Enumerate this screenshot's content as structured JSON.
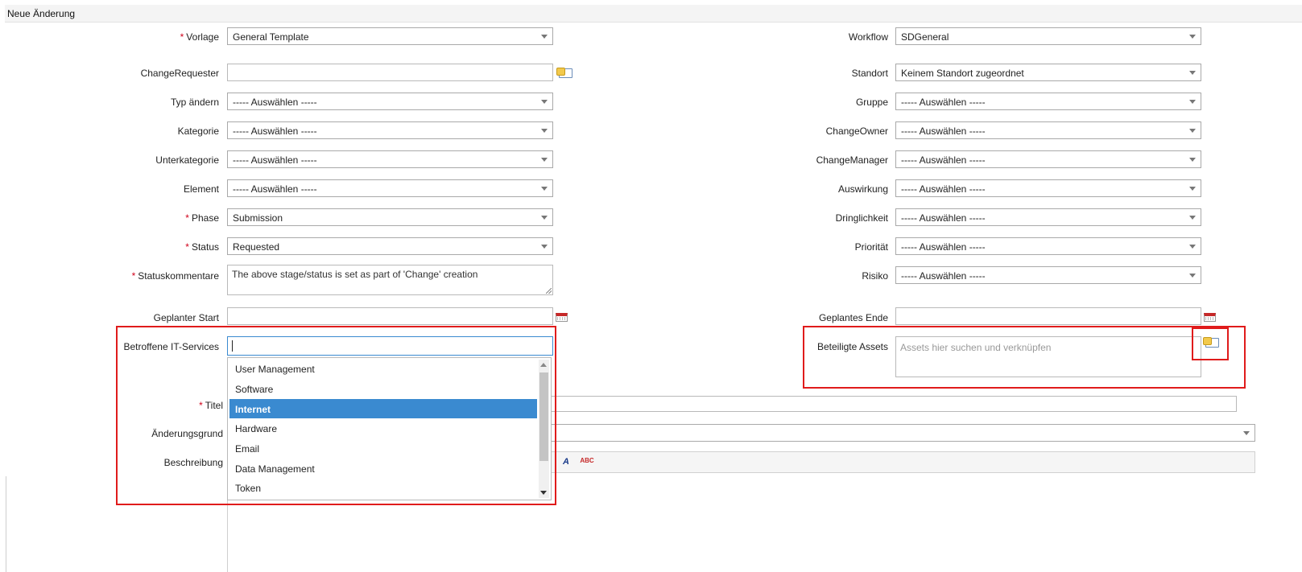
{
  "header": {
    "title": "Neue Änderung"
  },
  "left_fields": [
    {
      "key": "vorlage",
      "label": "Vorlage",
      "required": true,
      "value": "General Template"
    },
    {
      "key": "changerequester",
      "label": "ChangeRequester",
      "value": ""
    },
    {
      "key": "typ",
      "label": "Typ ändern",
      "value": "----- Auswählen -----"
    },
    {
      "key": "kategorie",
      "label": "Kategorie",
      "value": "----- Auswählen -----"
    },
    {
      "key": "unterkategorie",
      "label": "Unterkategorie",
      "value": "----- Auswählen -----"
    },
    {
      "key": "element",
      "label": "Element",
      "value": "----- Auswählen -----"
    },
    {
      "key": "phase",
      "label": "Phase",
      "required": true,
      "value": "Submission"
    },
    {
      "key": "status",
      "label": "Status",
      "required": true,
      "value": "Requested"
    },
    {
      "key": "statuskommentare",
      "label": "Statuskommentare",
      "required": true,
      "value": "The above stage/status is set as part of 'Change' creation"
    },
    {
      "key": "geplanter_start",
      "label": "Geplanter Start",
      "value": ""
    },
    {
      "key": "betroffene_services",
      "label": "Betroffene IT-Services",
      "value": ""
    }
  ],
  "right_fields": [
    {
      "key": "workflow",
      "label": "Workflow",
      "value": "SDGeneral"
    },
    {
      "key": "standort",
      "label": "Standort",
      "value": "Keinem Standort zugeordnet"
    },
    {
      "key": "gruppe",
      "label": "Gruppe",
      "value": "----- Auswählen -----"
    },
    {
      "key": "changeowner",
      "label": "ChangeOwner",
      "value": "----- Auswählen -----"
    },
    {
      "key": "changemanager",
      "label": "ChangeManager",
      "value": "----- Auswählen -----"
    },
    {
      "key": "auswirkung",
      "label": "Auswirkung",
      "value": "----- Auswählen -----"
    },
    {
      "key": "dringlichkeit",
      "label": "Dringlichkeit",
      "value": "----- Auswählen -----"
    },
    {
      "key": "prioritaet",
      "label": "Priorität",
      "value": "----- Auswählen -----"
    },
    {
      "key": "risiko",
      "label": "Risiko",
      "value": "----- Auswählen -----"
    },
    {
      "key": "geplantes_ende",
      "label": "Geplantes Ende",
      "value": ""
    },
    {
      "key": "beteiligte_assets",
      "label": "Beteiligte Assets",
      "placeholder": "Assets hier suchen und verknüpfen"
    }
  ],
  "lower_fields": [
    {
      "key": "titel",
      "label": "Titel",
      "required": true
    },
    {
      "key": "aenderungsgrund",
      "label": "Änderungsgrund"
    },
    {
      "key": "beschreibung",
      "label": "Beschreibung"
    }
  ],
  "services_dropdown": {
    "options": [
      "User Management",
      "Software",
      "Internet",
      "Hardware",
      "Email",
      "Data Management",
      "Token"
    ],
    "selected": "Internet"
  },
  "editor_toolbar": {
    "font_color_label": "A",
    "spellcheck_label": "ABC"
  },
  "icons": [
    "select-item-icon",
    "calendar-icon",
    "font-color-icon",
    "spellcheck-icon"
  ],
  "colors": {
    "highlight": "#3a8ad0",
    "required": "#d0021b",
    "annotation": "#e01b1b"
  }
}
